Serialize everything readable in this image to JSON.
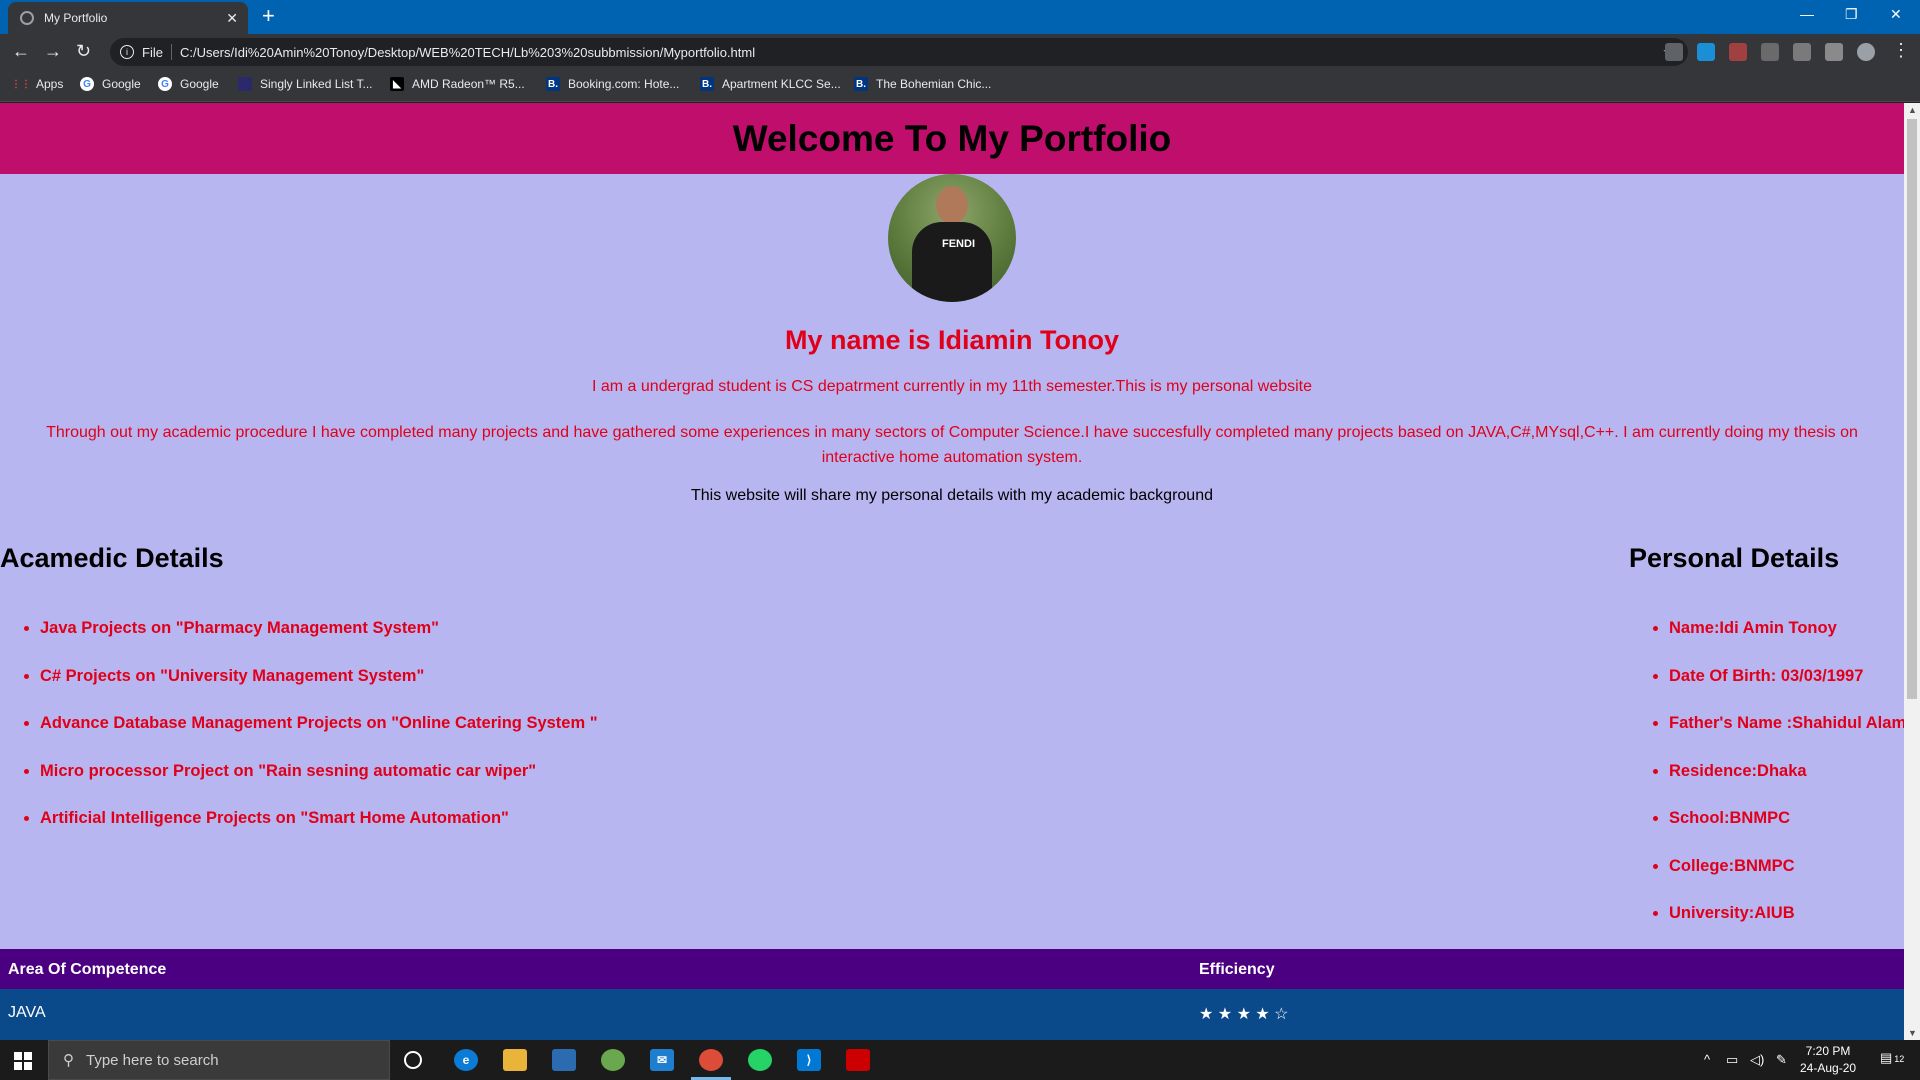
{
  "browser": {
    "tab_title": "My Portfolio",
    "new_tab": "+",
    "address_scheme": "File",
    "url": "C:/Users/Idi%20Amin%20Tonoy/Desktop/WEB%20TECH/Lb%203%20subbmission/Myportfolio.html",
    "bookmarks": [
      {
        "label": "Apps"
      },
      {
        "label": "Google"
      },
      {
        "label": "Google"
      },
      {
        "label": "Singly Linked List T..."
      },
      {
        "label": "AMD Radeon™ R5..."
      },
      {
        "label": "Booking.com: Hote..."
      },
      {
        "label": "Apartment KLCC Se..."
      },
      {
        "label": "The Bohemian Chic..."
      }
    ]
  },
  "page": {
    "header_title": "Welcome To My Portfolio",
    "name_heading": "My name is Idiamin Tonoy",
    "intro": "I am a undergrad student is CS depatrment currently in my 11th semester.This is my personal website",
    "description": "Through out my academic procedure I have completed many projects and have gathered some experiences in many sectors of Computer Science.I have succesfully completed many projects based on JAVA,C#,MYsql,C++. I am currently doing my thesis on interactive home automation system.",
    "summary": "This website will share my personal details with my academic background",
    "academic": {
      "heading": "Acamedic Details",
      "items": [
        "Java Projects on \"Pharmacy Management System\"",
        "C# Projects on \"University Management System\"",
        "Advance Database Management Projects on \"Online Catering System \"",
        "Micro processor Project on \"Rain sesning automatic car wiper\"",
        "Artificial Intelligence Projects on \"Smart Home Automation\""
      ]
    },
    "personal": {
      "heading": "Personal Details",
      "items": [
        "Name:Idi Amin Tonoy",
        "Date Of Birth: 03/03/1997",
        "Father's Name :Shahidul Alam",
        "Residence:Dhaka",
        "School:BNMPC",
        "College:BNMPC",
        "University:AIUB"
      ]
    },
    "competence_table": {
      "headers": [
        "Area Of Competence",
        "Efficiency"
      ],
      "rows": [
        [
          "JAVA",
          "★ ★ ★ ★ ☆"
        ]
      ]
    },
    "avatar_shirt_text": "FENDI"
  },
  "taskbar": {
    "search_placeholder": "Type here to search",
    "time": "7:20 PM",
    "date": "24-Aug-20",
    "notification_count": "12"
  },
  "colors": {
    "header_bg": "#c00e6d",
    "page_bg": "#b8b6f0",
    "accent_red": "#e0001a",
    "table_head_bg": "#4b0082",
    "table_row_bg": "#0a4a8a"
  }
}
